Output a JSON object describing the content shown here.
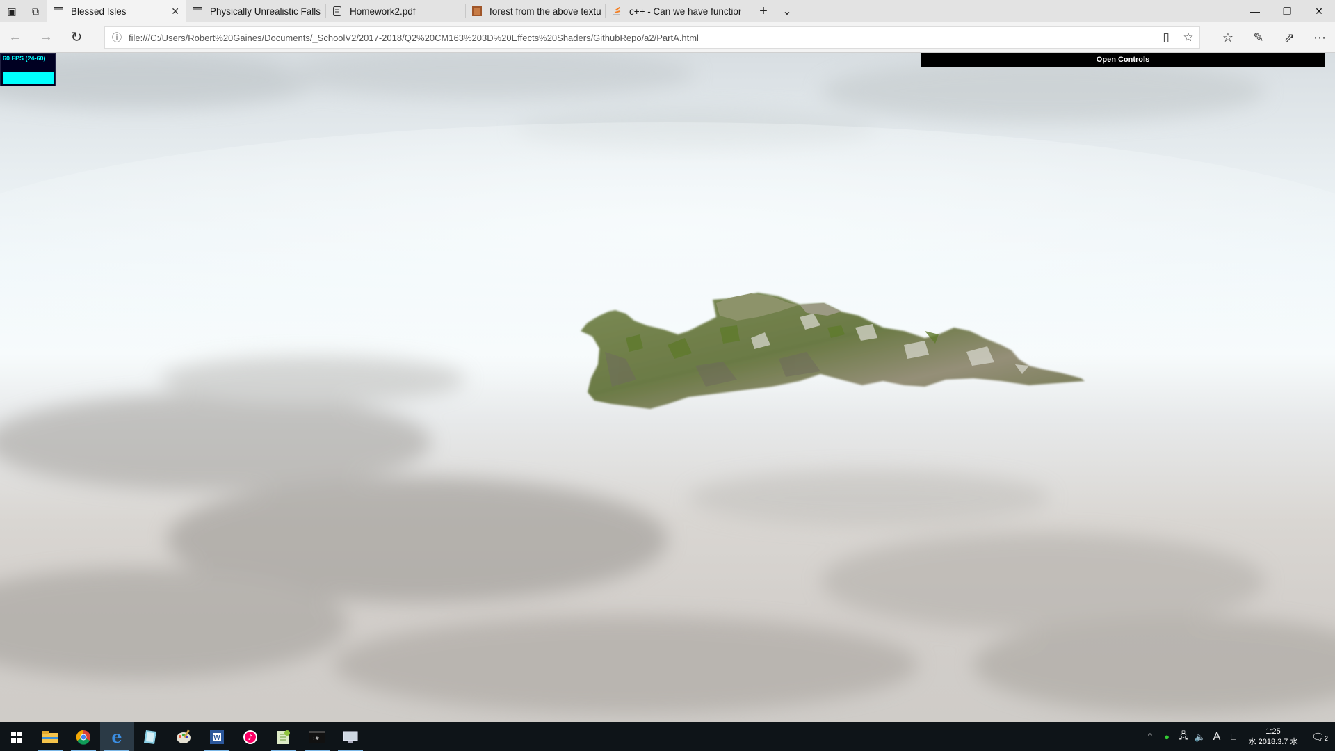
{
  "browser": {
    "tabs": [
      {
        "label": "Blessed Isles",
        "icon": "page-icon",
        "active": true
      },
      {
        "label": "Physically Unrealistic Falls",
        "icon": "page-icon",
        "active": false
      },
      {
        "label": "Homework2.pdf",
        "icon": "pdf-icon",
        "active": false
      },
      {
        "label": "forest from the above textu",
        "icon": "image-icon",
        "active": false
      },
      {
        "label": "c++ - Can we have functior",
        "icon": "stackoverflow-icon",
        "active": false
      }
    ],
    "new_tab_label": "+",
    "tab_list_label": "⌄",
    "url": "file:///C:/Users/Robert%20Gaines/Documents/_SchoolV2/2017-2018/Q2%20CM163%203D%20Effects%20Shaders/GithubRepo/a2/PartA.html"
  },
  "page": {
    "fps_label": "60 FPS (24-60)",
    "open_controls_label": "Open Controls"
  },
  "taskbar": {
    "apps": [
      "start-icon",
      "file-explorer-icon",
      "chrome-icon",
      "edge-icon",
      "notepad-icon",
      "paint-icon",
      "word-icon",
      "itunes-icon",
      "notepadpp-icon",
      "cmd-icon",
      "remote-icon"
    ],
    "clock_time": "1:25",
    "clock_date": "水 2018.3.7 水",
    "ime_label": "A",
    "notification_count": "2"
  },
  "colors": {
    "fps_text": "#00ffff",
    "taskbar_bg": "#0e1418",
    "terrain_green": "#6b7a45"
  }
}
